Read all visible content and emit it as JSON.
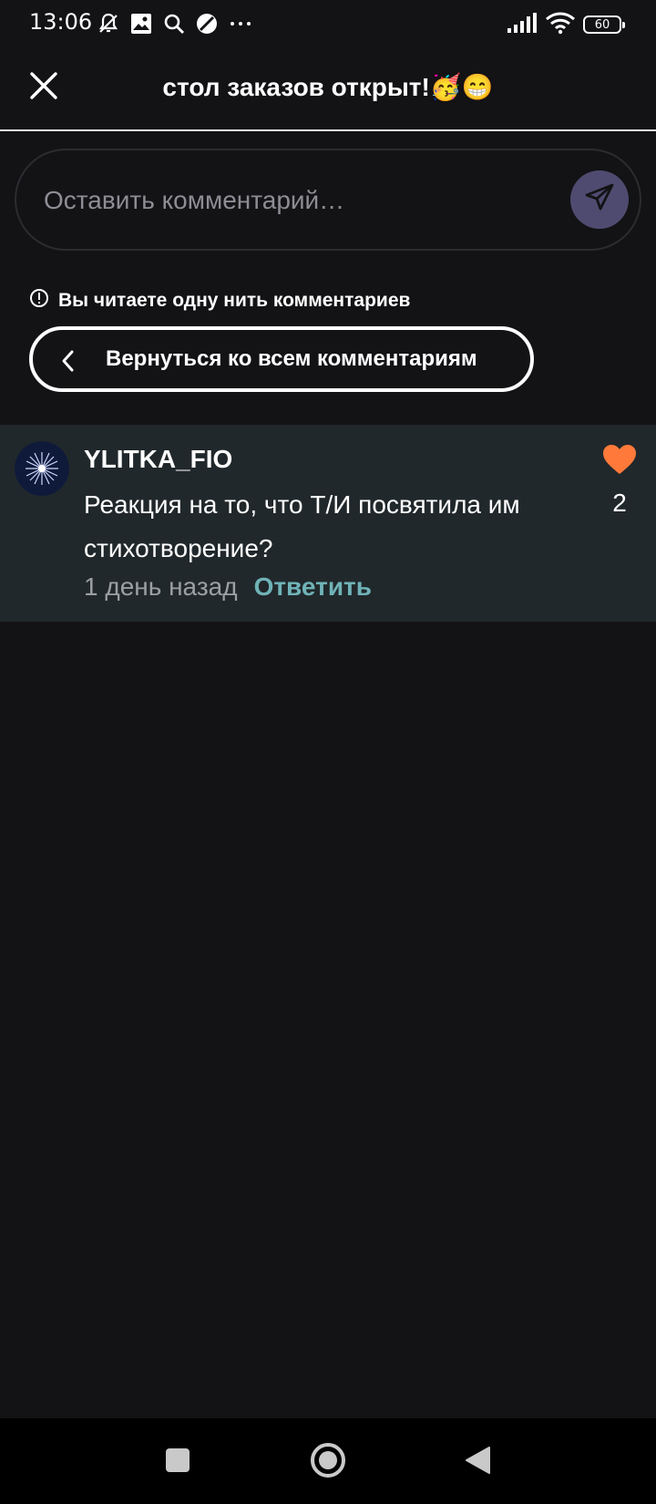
{
  "status_bar": {
    "time": "13:06",
    "battery": "60",
    "icons": [
      "mute-notifications-icon",
      "gallery-icon",
      "search-icon",
      "app-icon",
      "more-icon",
      "signal-icon",
      "wifi-icon",
      "battery-icon"
    ]
  },
  "header": {
    "title": "стол заказов открыт!🥳😁"
  },
  "comment_input": {
    "placeholder": "Оставить комментарий…"
  },
  "thread": {
    "notice": "Вы читаете одну нить комментариев",
    "back_label": "Вернуться ко всем комментариям"
  },
  "comment": {
    "username": "YLITKA_FIO",
    "text": "Реакция на то, что Т/И посвятила им стихотворение?",
    "timestamp": "1 день назад",
    "reply_label": "Ответить",
    "likes": "2"
  },
  "colors": {
    "background": "#131215",
    "card_background": "#21282b",
    "accent_reply": "#6fb3b8",
    "heart": "#ff7a3a",
    "send_button": "#4f4b70"
  }
}
